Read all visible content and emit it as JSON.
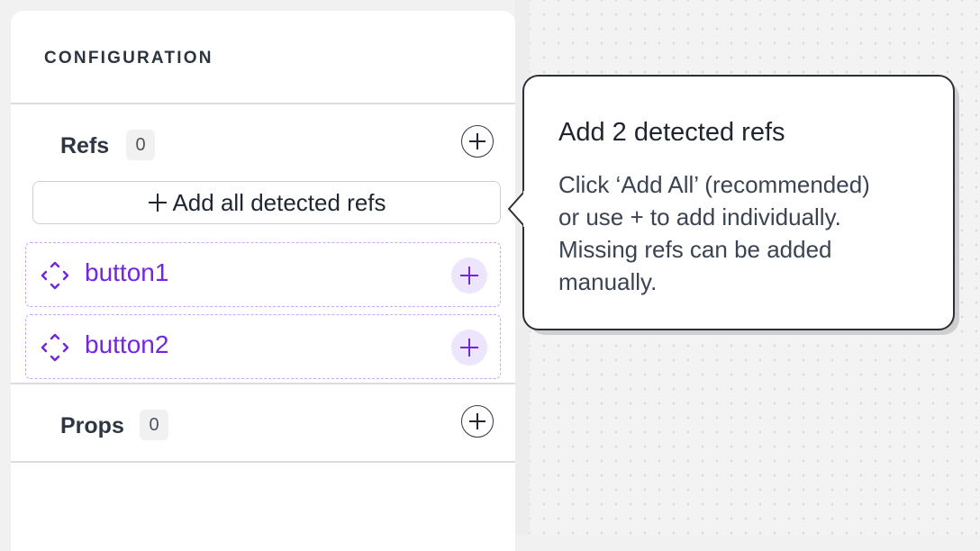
{
  "sidebar": {
    "title": "CONFIGURATION",
    "refs": {
      "label": "Refs",
      "count": "0",
      "add_all_label": "Add all detected refs",
      "items": [
        {
          "label": "button1"
        },
        {
          "label": "button2"
        }
      ]
    },
    "props": {
      "label": "Props",
      "count": "0"
    }
  },
  "tooltip": {
    "title": "Add 2 detected refs",
    "body_lines": [
      "Click ‘Add All’ (recommended)",
      "or use + to add individually.",
      "Missing refs can be added",
      "manually."
    ]
  },
  "icons": {
    "section_add": "plus-circle-icon",
    "add_all": "plus-icon",
    "ref_item": "dashed-target-icon",
    "ref_add": "plus-icon"
  },
  "colors": {
    "accent_purple": "#7226df",
    "ref_border": "#c7a9f3",
    "ref_add_bg": "#ece5fb",
    "text_dark": "#2d3642",
    "tooltip_border": "#2b2f36"
  }
}
